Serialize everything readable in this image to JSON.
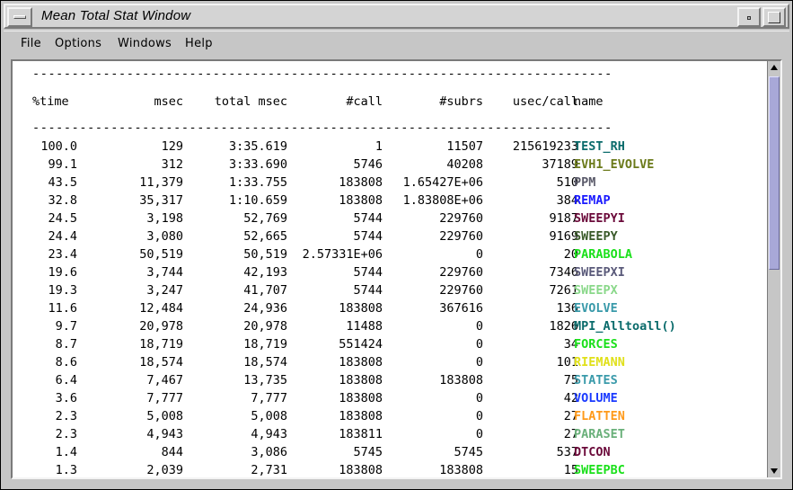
{
  "window": {
    "title": "Mean Total Stat Window"
  },
  "menubar": {
    "items": [
      "File",
      "Options",
      "Windows",
      "Help"
    ]
  },
  "table": {
    "separator": "--------------------------------------------------------------------------",
    "headers": {
      "time": "%time",
      "msec": "msec",
      "total": "total msec",
      "call": "#call",
      "subrs": "#subrs",
      "usec": "usec/call",
      "name": "name"
    },
    "rows": [
      {
        "time": "100.0",
        "msec": "129",
        "total": "3:35.619",
        "call": "1",
        "subrs": "11507",
        "usec": "215619233",
        "name": "TEST_RH",
        "color": "#0a6b6b"
      },
      {
        "time": "99.1",
        "msec": "312",
        "total": "3:33.690",
        "call": "5746",
        "subrs": "40208",
        "usec": "37189",
        "name": "EVH1_EVOLVE",
        "color": "#6b7a1a"
      },
      {
        "time": "43.5",
        "msec": "11,379",
        "total": "1:33.755",
        "call": "183808",
        "subrs": "1.65427E+06",
        "usec": "510",
        "name": "PPM",
        "color": "#5a5a6a"
      },
      {
        "time": "32.8",
        "msec": "35,317",
        "total": "1:10.659",
        "call": "183808",
        "subrs": "1.83808E+06",
        "usec": "384",
        "name": "REMAP",
        "color": "#1a1aff"
      },
      {
        "time": "24.5",
        "msec": "3,198",
        "total": "52,769",
        "call": "5744",
        "subrs": "229760",
        "usec": "9187",
        "name": "SWEEPYI",
        "color": "#6b0a3a"
      },
      {
        "time": "24.4",
        "msec": "3,080",
        "total": "52,665",
        "call": "5744",
        "subrs": "229760",
        "usec": "9169",
        "name": "SWEEPY",
        "color": "#3a5a2a"
      },
      {
        "time": "23.4",
        "msec": "50,519",
        "total": "50,519",
        "call": "2.57331E+06",
        "subrs": "0",
        "usec": "20",
        "name": "PARABOLA",
        "color": "#1ae01a"
      },
      {
        "time": "19.6",
        "msec": "3,744",
        "total": "42,193",
        "call": "5744",
        "subrs": "229760",
        "usec": "7346",
        "name": "SWEEPXI",
        "color": "#5a5a7a"
      },
      {
        "time": "19.3",
        "msec": "3,247",
        "total": "41,707",
        "call": "5744",
        "subrs": "229760",
        "usec": "7261",
        "name": "SWEEPX",
        "color": "#8ad88a"
      },
      {
        "time": "11.6",
        "msec": "12,484",
        "total": "24,936",
        "call": "183808",
        "subrs": "367616",
        "usec": "136",
        "name": "EVOLVE",
        "color": "#3a9aaa"
      },
      {
        "time": "9.7",
        "msec": "20,978",
        "total": "20,978",
        "call": "11488",
        "subrs": "0",
        "usec": "1826",
        "name": "MPI_Alltoall()",
        "color": "#0a6b6b"
      },
      {
        "time": "8.7",
        "msec": "18,719",
        "total": "18,719",
        "call": "551424",
        "subrs": "0",
        "usec": "34",
        "name": "FORCES",
        "color": "#1ae01a"
      },
      {
        "time": "8.6",
        "msec": "18,574",
        "total": "18,574",
        "call": "183808",
        "subrs": "0",
        "usec": "101",
        "name": "RIEMANN",
        "color": "#e0e01a"
      },
      {
        "time": "6.4",
        "msec": "7,467",
        "total": "13,735",
        "call": "183808",
        "subrs": "183808",
        "usec": "75",
        "name": "STATES",
        "color": "#3a9aaa"
      },
      {
        "time": "3.6",
        "msec": "7,777",
        "total": "7,777",
        "call": "183808",
        "subrs": "0",
        "usec": "42",
        "name": "VOLUME",
        "color": "#1a3aff"
      },
      {
        "time": "2.3",
        "msec": "5,008",
        "total": "5,008",
        "call": "183808",
        "subrs": "0",
        "usec": "27",
        "name": "FLATTEN",
        "color": "#ff9a1a"
      },
      {
        "time": "2.3",
        "msec": "4,943",
        "total": "4,943",
        "call": "183811",
        "subrs": "0",
        "usec": "27",
        "name": "PARASET",
        "color": "#6ab07a"
      },
      {
        "time": "1.4",
        "msec": "844",
        "total": "3,086",
        "call": "5745",
        "subrs": "5745",
        "usec": "537",
        "name": "DTCON",
        "color": "#6b0a3a"
      },
      {
        "time": "1.3",
        "msec": "2,039",
        "total": "2,731",
        "call": "183808",
        "subrs": "183808",
        "usec": "15",
        "name": "SWEEPBC",
        "color": "#1ae01a"
      }
    ]
  }
}
